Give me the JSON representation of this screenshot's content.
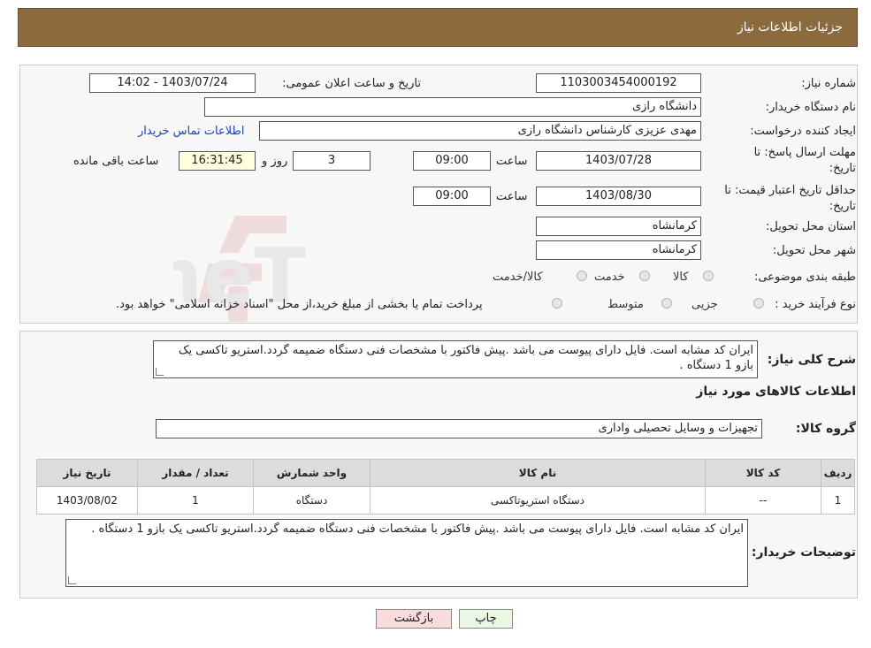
{
  "header": {
    "title": "جزئیات اطلاعات نیاز"
  },
  "fields": {
    "need_number_label": "شماره نیاز:",
    "need_number": "1103003454000192",
    "announce_label": "تاریخ و ساعت اعلان عمومی:",
    "announce_value": "1403/07/24 - 14:02",
    "buyer_org_label": "نام دستگاه خریدار:",
    "buyer_org": "دانشگاه رازی",
    "creator_label": "ایجاد کننده درخواست:",
    "creator": "مهدی عزیزی کارشناس دانشگاه رازی",
    "contact_link": "اطلاعات تماس خریدار",
    "deadline_label": "مهلت ارسال پاسخ: تا تاریخ:",
    "deadline_date": "1403/07/28",
    "time_label": "ساعت",
    "deadline_time": "09:00",
    "days": "3",
    "days_label": "روز و",
    "remaining_time": "16:31:45",
    "remaining_label": "ساعت باقی مانده",
    "validity_label": "حداقل تاریخ اعتبار قیمت: تا تاریخ:",
    "validity_date": "1403/08/30",
    "validity_time": "09:00",
    "province_label": "استان محل تحویل:",
    "province": "کرمانشاه",
    "city_label": "شهر محل تحویل:",
    "city": "کرمانشاه",
    "category_label": "طبقه بندی موضوعی:",
    "category_options": [
      "کالا",
      "خدمت",
      "کالا/خدمت"
    ],
    "process_label": "نوع فرآیند خرید :",
    "process_options": [
      "جزیی",
      "متوسط"
    ],
    "payment_note": "پرداخت تمام یا بخشی از مبلغ خرید،از محل \"اسناد خزانه اسلامی\" خواهد بود."
  },
  "description": {
    "label": "شرح کلی نیاز:",
    "text": "ایران کد مشابه است. فایل دارای پیوست می باشد .پیش فاکتور با مشخصات فنی دستگاه ضمیمه گردد.استریو تاکسی یک بازو 1 دستگاه ."
  },
  "goods": {
    "section_title": "اطلاعات کالاهای مورد نیاز",
    "group_label": "گروه کالا:",
    "group_value": "تجهیزات و وسایل تحصیلی واداری",
    "columns": [
      "ردیف",
      "کد کالا",
      "نام کالا",
      "واحد شمارش",
      "تعداد / مقدار",
      "تاریخ نیاز"
    ],
    "rows": [
      [
        "1",
        "--",
        "دستگاه استریوتاکسی",
        "دستگاه",
        "1",
        "1403/08/02"
      ]
    ]
  },
  "buyer_notes": {
    "label": "توضیحات خریدار:",
    "text": "ایران کد مشابه است. فایل دارای پیوست می باشد .پیش فاکتور با مشخصات فنی دستگاه ضمیمه گردد.استریو تاکسی یک بازو 1 دستگاه ."
  },
  "buttons": {
    "print": "چاپ",
    "back": "بازگشت"
  },
  "watermark": {
    "text": "AriaTender.neT"
  },
  "colors": {
    "header_bg": "#8b6a3e",
    "link": "#1a3fc8",
    "remaining_bg": "#ffffe0",
    "back_btn_bg": "#f8dcdc",
    "print_btn_bg": "#e9f7e3"
  }
}
